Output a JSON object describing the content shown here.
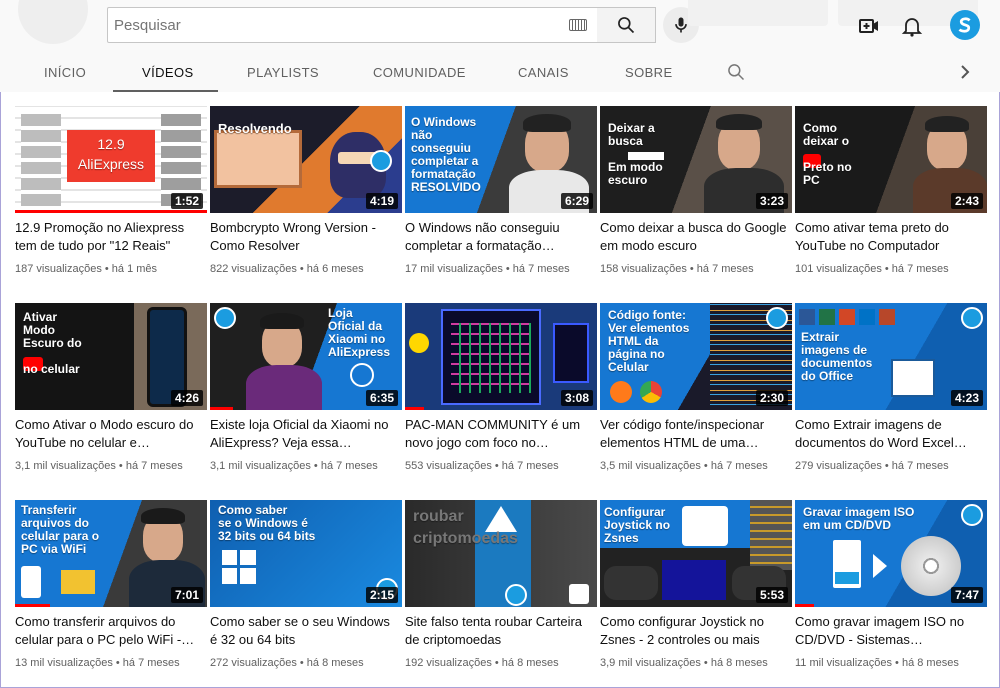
{
  "search": {
    "placeholder": "Pesquisar"
  },
  "tabs": [
    {
      "label": "INÍCIO"
    },
    {
      "label": "VÍDEOS"
    },
    {
      "label": "PLAYLISTS"
    },
    {
      "label": "COMUNIDADE"
    },
    {
      "label": "CANAIS"
    },
    {
      "label": "SOBRE"
    }
  ],
  "active_tab": "VÍDEOS",
  "icons": [
    "keyboard-icon",
    "search-icon",
    "mic-icon",
    "create-video-icon",
    "bell-icon",
    "channel-avatar",
    "chevron-right-icon"
  ],
  "colors": {
    "progress": "#ff0000",
    "accent": "#1b9ce0",
    "tab_underline": "#606060"
  },
  "videos": [
    {
      "title": "12.9 Promoção no Aliexpress tem de tudo por \"12 Reais\"",
      "meta": "187 visualizações • há 1 mês",
      "duration": "1:52",
      "thumb_text": "12.9\nAliExpress",
      "watched": 1.0
    },
    {
      "title": "Bombcrypto Wrong Version - Como Resolver",
      "meta": "822 visualizações • há 6 meses",
      "duration": "4:19",
      "thumb_text": "Resolvendo",
      "watched": 0
    },
    {
      "title": "O Windows não conseguiu completar a formatação…",
      "meta": "17 mil visualizações • há 7 meses",
      "duration": "6:29",
      "thumb_text": "O Windows\nnão\nconseguiu\ncompletar a\nformatação\nRESOLVIDO",
      "watched": 0
    },
    {
      "title": "Como deixar a busca do Google em modo escuro",
      "meta": "158 visualizações • há 7 meses",
      "duration": "3:23",
      "thumb_text": "Deixar a\nbusca\n\nEm modo\nescuro",
      "watched": 0
    },
    {
      "title": "Como ativar tema preto do YouTube no Computador",
      "meta": "101 visualizações • há 7 meses",
      "duration": "2:43",
      "thumb_text": "Como\ndeixar o\n\nPreto no\nPC",
      "watched": 0
    },
    {
      "title": "Como Ativar o Modo escuro do YouTube no celular e…",
      "meta": "3,1 mil visualizações • há 7 meses",
      "duration": "4:26",
      "thumb_text": "Ativar\nModo\nEscuro do\n\nno celular",
      "watched": 0
    },
    {
      "title": "Existe loja Oficial da Xiaomi no AliExpress? Veja essa…",
      "meta": "3,1 mil visualizações • há 7 meses",
      "duration": "6:35",
      "thumb_text": "Loja\nOficial da\nXiaomi no\nAliExpress",
      "watched": 0.12
    },
    {
      "title": "PAC-MAN COMMUNITY é um novo jogo com foco no…",
      "meta": "553 visualizações • há 7 meses",
      "duration": "3:08",
      "thumb_text": "",
      "watched": 0.1
    },
    {
      "title": "Ver código fonte/inspecionar elementos HTML de uma…",
      "meta": "3,5 mil visualizações • há 7 meses",
      "duration": "2:30",
      "thumb_text": "Código fonte:\nVer elementos\nHTML da\npágina no\nCelular",
      "watched": 0
    },
    {
      "title": "Como Extrair imagens de documentos do Word Excel…",
      "meta": "279 visualizações • há 7 meses",
      "duration": "4:23",
      "thumb_text": "Extrair\nimagens de\ndocumentos\ndo Office",
      "watched": 0
    },
    {
      "title": "Como transferir arquivos do celular para o PC pelo WiFi -…",
      "meta": "13 mil visualizações • há 7 meses",
      "duration": "7:01",
      "thumb_text": "Transferir\narquivos do\ncelular para o\nPC via WiFi",
      "watched": 0.18
    },
    {
      "title": "Como saber se o seu Windows é 32 ou 64 bits",
      "meta": "272 visualizações • há 8 meses",
      "duration": "2:15",
      "thumb_text": "Como saber\nse o Windows é\n32 bits ou 64 bits",
      "watched": 0
    },
    {
      "title": "Site falso tenta roubar Carteira de criptomoedas",
      "meta": "192 visualizações • há 8 meses",
      "duration": "",
      "thumb_text": "roubar\ncriptomoedas",
      "watched": 0
    },
    {
      "title": "Como configurar Joystick no Zsnes - 2 controles ou mais",
      "meta": "3,9 mil visualizações • há 8 meses",
      "duration": "5:53",
      "thumb_text": "Configurar\nJoystick no\nZsnes",
      "watched": 0
    },
    {
      "title": "Como gravar imagem ISO no CD/DVD - Sistemas…",
      "meta": "11 mil visualizações • há 8 meses",
      "duration": "7:47",
      "thumb_text": "Gravar imagem ISO\nem um CD/DVD",
      "watched": 0.1
    }
  ]
}
